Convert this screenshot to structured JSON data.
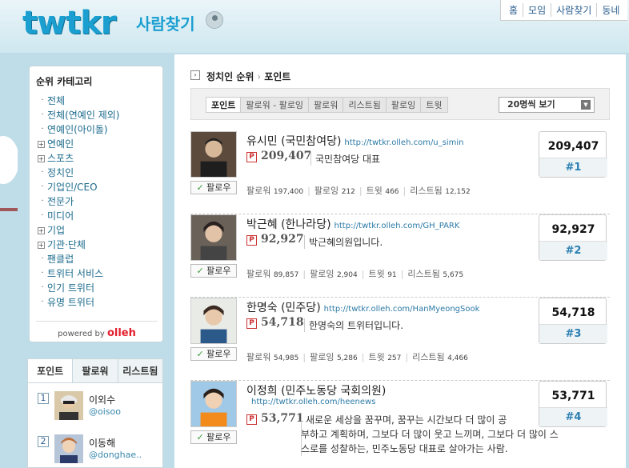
{
  "brand": {
    "logo": "twtkr",
    "subtitle": "사람찾기"
  },
  "topnav": [
    "홈",
    "모임",
    "사람찾기",
    "동네"
  ],
  "categories": {
    "title": "순위 카테고리",
    "items": [
      {
        "label": "전체",
        "expand": false
      },
      {
        "label": "전체(연예인 제외)",
        "expand": false
      },
      {
        "label": "연예인(아이돌)",
        "expand": false
      },
      {
        "label": "연예인",
        "expand": true
      },
      {
        "label": "스포츠",
        "expand": true
      },
      {
        "label": "정치인",
        "expand": false
      },
      {
        "label": "기업인/CEO",
        "expand": false
      },
      {
        "label": "전문가",
        "expand": false
      },
      {
        "label": "미디어",
        "expand": false
      },
      {
        "label": "기업",
        "expand": true
      },
      {
        "label": "기관·단체",
        "expand": true
      },
      {
        "label": "팬클럽",
        "expand": false
      },
      {
        "label": "트위터 서비스",
        "expand": false
      },
      {
        "label": "인기 트위터",
        "expand": false
      },
      {
        "label": "유명 트위터",
        "expand": false
      }
    ],
    "powered": "powered by",
    "powered_brand": "olleh"
  },
  "side_rank": {
    "tabs": [
      "포인트",
      "팔로워",
      "리스트됨"
    ],
    "items": [
      {
        "rank": "1",
        "name": "이외수",
        "id": "@oisoo"
      },
      {
        "rank": "2",
        "name": "이동해",
        "id": "@donghae.."
      }
    ]
  },
  "breadcrumb": {
    "parent": "정치인 순위",
    "current": "포인트"
  },
  "sort_tabs": [
    "포인트",
    "팔로워 - 팔로잉",
    "팔로워",
    "리스트됨",
    "팔로잉",
    "트윗"
  ],
  "per_page": "20명씩 보기",
  "labels": {
    "follow": "팔로우",
    "followers": "팔로워",
    "following": "팔로잉",
    "tweets": "트윗",
    "listed": "리스트됨",
    "p": "P"
  },
  "people": [
    {
      "name": "유시민 (국민참여당)",
      "url": "http://twtkr.olleh.com/u_simin",
      "point": "209,407",
      "desc": "국민참여당 대표",
      "followers": "197,400",
      "following": "212",
      "tweets": "466",
      "listed": "12,152",
      "score": "209,407",
      "rank": "#1"
    },
    {
      "name": "박근혜 (한나라당)",
      "url": "http://twtkr.olleh.com/GH_PARK",
      "point": "92,927",
      "desc": "박근혜의원입니다.",
      "followers": "89,857",
      "following": "2,904",
      "tweets": "91",
      "listed": "5,675",
      "score": "92,927",
      "rank": "#2"
    },
    {
      "name": "한명숙 (민주당)",
      "url": "http://twtkr.olleh.com/HanMyeongSook",
      "point": "54,718",
      "desc": "한명숙의 트위터입니다.",
      "followers": "54,985",
      "following": "5,286",
      "tweets": "257",
      "listed": "4,466",
      "score": "54,718",
      "rank": "#3"
    },
    {
      "name": "이정희 (민주노동당 국회의원)",
      "url": "http://twtkr.olleh.com/heenews",
      "point": "53,771",
      "desc_lines": [
        "새로운 세상을 꿈꾸며, 꿈꾸는 시간보다 더 많이 공",
        "부하고 계획하며, 그보다 더 많이 웃고 느끼며, 그보다 더 많이 스",
        "스로를 성찰하는, 민주노동당 대표로 살아가는 사람."
      ],
      "score": "53,771",
      "rank": "#4"
    }
  ]
}
